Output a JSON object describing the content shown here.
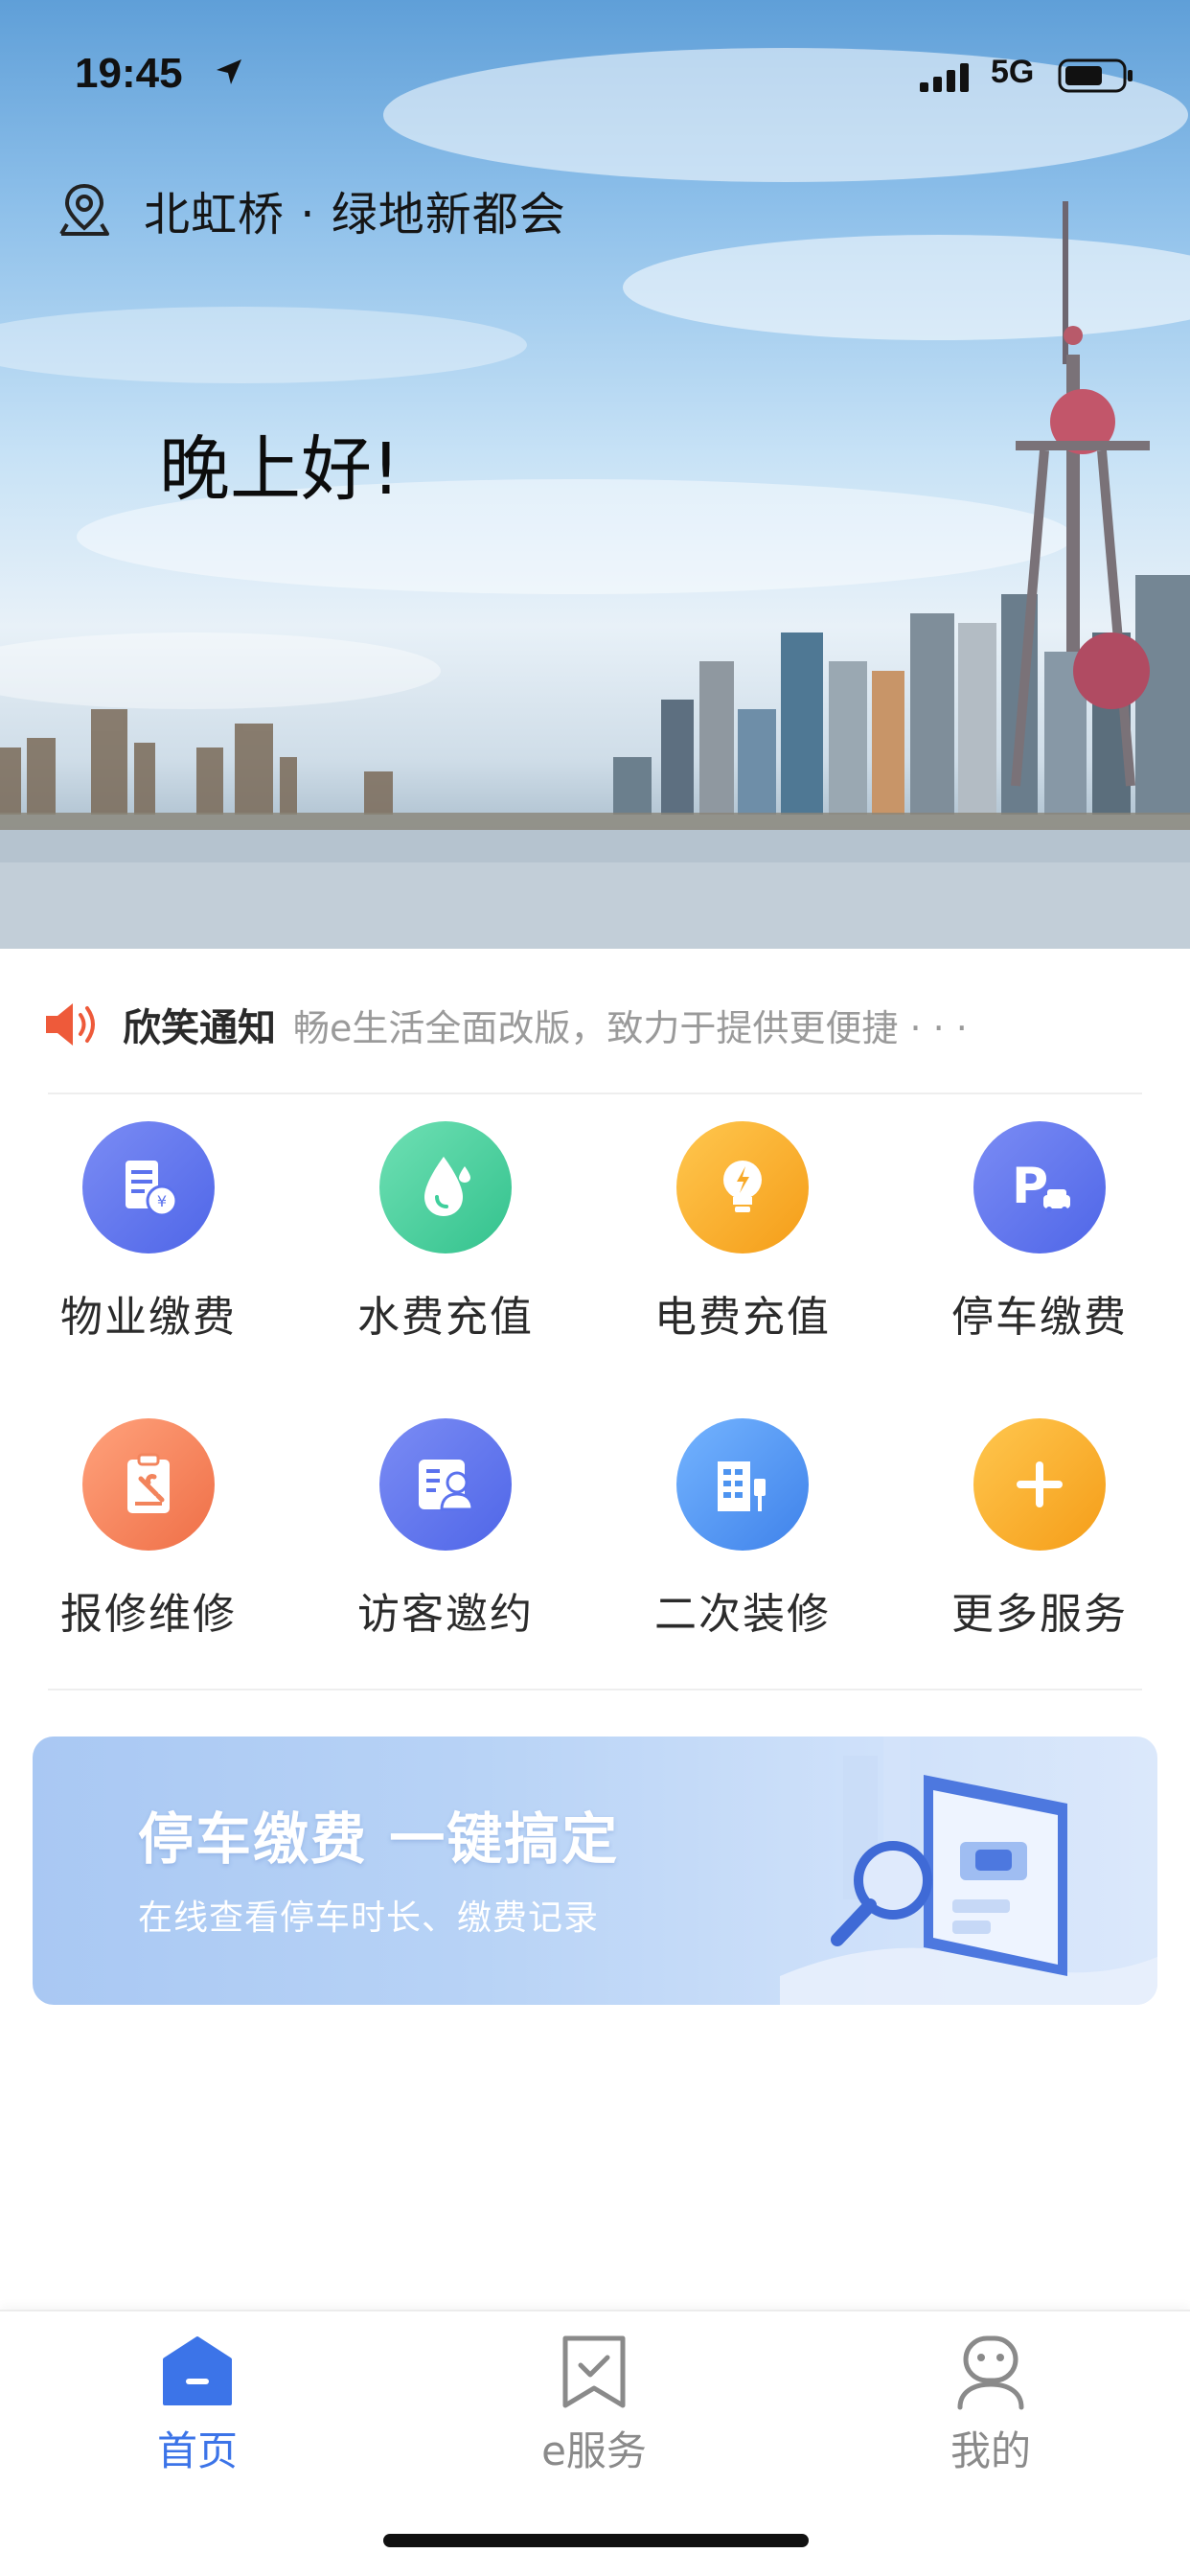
{
  "status_bar": {
    "time": "19:45",
    "network": "5G"
  },
  "location": {
    "name": "北虹桥 · 绿地新都会"
  },
  "greeting": "晚上好!",
  "notice": {
    "title": "欣笑通知",
    "text": "畅e生活全面改版，致力于提供更便捷 · · ·"
  },
  "services": [
    {
      "label": "物业缴费",
      "icon": "property-bill-icon",
      "color": "#5b72ee"
    },
    {
      "label": "水费充值",
      "icon": "water-drop-icon",
      "color": "#3fcf9c"
    },
    {
      "label": "电费充值",
      "icon": "lightbulb-icon",
      "color": "#f7a928"
    },
    {
      "label": "停车缴费",
      "icon": "parking-icon",
      "color": "#5b72ee"
    },
    {
      "label": "报修维修",
      "icon": "repair-clipboard-icon",
      "color": "#f2845c"
    },
    {
      "label": "访客邀约",
      "icon": "visitor-card-icon",
      "color": "#5b72ee"
    },
    {
      "label": "二次装修",
      "icon": "building-brush-icon",
      "color": "#4e94f0"
    },
    {
      "label": "更多服务",
      "icon": "plus-icon",
      "color": "#f7a928"
    }
  ],
  "banner": {
    "title": "停车缴费 一键搞定",
    "subtitle": "在线查看停车时长、缴费记录"
  },
  "tabs": [
    {
      "label": "首页",
      "icon": "home-icon",
      "active": true
    },
    {
      "label": "e服务",
      "icon": "bookmark-check-icon",
      "active": false
    },
    {
      "label": "我的",
      "icon": "profile-icon",
      "active": false
    }
  ],
  "colors": {
    "accent": "#3c74e8",
    "notice_icon": "#ee5a3a"
  }
}
